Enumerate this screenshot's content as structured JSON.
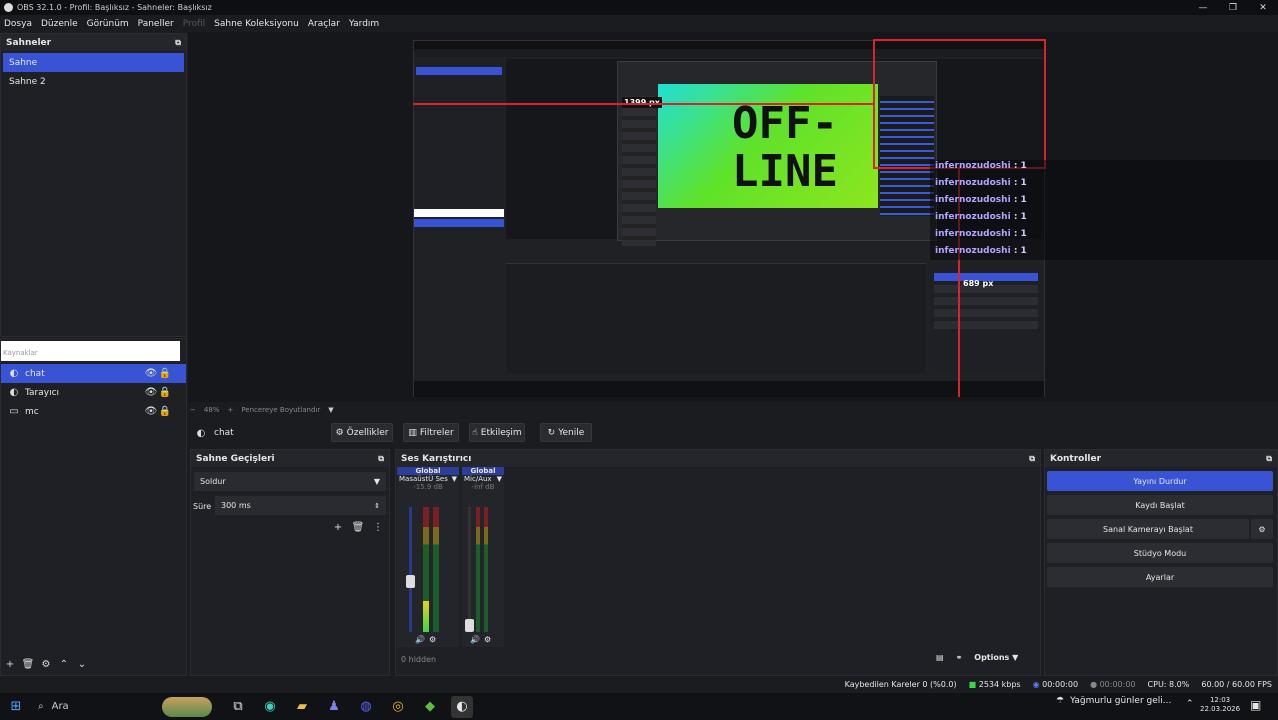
{
  "window": {
    "title": "OBS 32.1.0 - Profil: Başlıksız - Sahneler: Başlıksız"
  },
  "menu": [
    "Dosya",
    "Düzenle",
    "Görünüm",
    "Paneller",
    "Profil",
    "Sahne Koleksiyonu",
    "Araçlar",
    "Yardım"
  ],
  "scenes": {
    "header": "Sahneler",
    "items": [
      "Sahne",
      "Sahne 2"
    ]
  },
  "sources": {
    "header": "Kaynaklar",
    "items": [
      "chat",
      "Tarayıcı",
      "mc"
    ]
  },
  "preview": {
    "zoom": "48%",
    "fit_label": "Pencereye Boyutlandır",
    "overlay_text": "OFF-\nLINE",
    "px_label_top": "1399 px",
    "px_label_right": "689 px",
    "chat_lines": [
      {
        "user": "infernozudoshi",
        "msg": ": 1"
      },
      {
        "user": "infernozudoshi",
        "msg": ": 1"
      },
      {
        "user": "infernozudoshi",
        "msg": ": 1"
      },
      {
        "user": "infernozudoshi",
        "msg": ": 1"
      },
      {
        "user": "infernozudoshi",
        "msg": ": 1"
      },
      {
        "user": "infernozudoshi",
        "msg": ": 1"
      }
    ]
  },
  "source_toolbar": {
    "selected": "chat",
    "properties": "Özellikler",
    "filters": "Filtreler",
    "interact": "Etkileşim",
    "refresh": "Yenile"
  },
  "transitions": {
    "header": "Sahne Geçişleri",
    "type": "Soldur",
    "duration_label": "Süre",
    "duration": "300 ms"
  },
  "mixer": {
    "header": "Ses Karıştırıcı",
    "channels": [
      {
        "tag": "Global",
        "name": "MasaüstÜ Ses",
        "db": "-15.9 dB",
        "level": 0.25
      },
      {
        "tag": "Global",
        "name": "Mic/Aux",
        "db": "-inf dB",
        "level": 0.0
      }
    ],
    "scale": [
      "0",
      "-5",
      "-10",
      "-15",
      "-20",
      "-25",
      "-30",
      "-35",
      "-40",
      "-45",
      "-50",
      "-55",
      "-60"
    ],
    "hidden": "0 hidden",
    "options": "Options"
  },
  "controls": {
    "header": "Kontroller",
    "stop_stream": "Yayını Durdur",
    "start_record": "Kaydı Başlat",
    "virtual_cam": "Sanal Kamerayı Başlat",
    "studio_mode": "Stüdyo Modu",
    "settings": "Ayarlar"
  },
  "status": {
    "dropped": "Kaybedilen Kareler 0 (%0.0)",
    "bitrate": "2534 kbps",
    "stream_time": "00:00:00",
    "rec_time": "00:00:00",
    "cpu": "CPU: 8.0%",
    "fps": "60.00 / 60.00 FPS"
  },
  "taskbar": {
    "search": "Ara",
    "weather": "Yağmurlu günler geli...",
    "time": "12:03",
    "date": "22.03.2026"
  },
  "colors": {
    "accent": "#3854d4",
    "red": "#d8242c",
    "bg": "#1b1c20"
  }
}
